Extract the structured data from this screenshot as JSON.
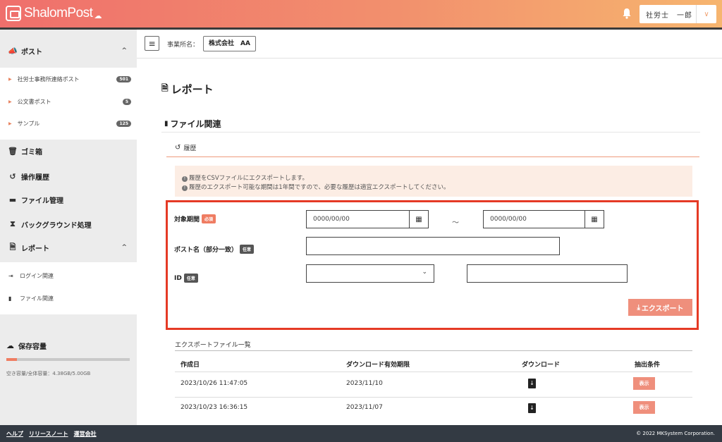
{
  "header": {
    "logo_text": "ShalomPost",
    "user_name": "社労士　一郎",
    "user_chevron": "∨"
  },
  "sidebar": {
    "post": {
      "label": "ポスト",
      "caret": "^"
    },
    "post_items": [
      {
        "label": "社労士事務所連絡ポスト",
        "badge": "501"
      },
      {
        "label": "公文書ポスト",
        "badge": "5"
      },
      {
        "label": "サンプル",
        "badge": "125"
      }
    ],
    "trash": "ゴミ箱",
    "history": "操作履歴",
    "files": "ファイル管理",
    "background": "バックグラウンド処理",
    "report": {
      "label": "レポート",
      "caret": "^"
    },
    "report_items": [
      {
        "label": "ログイン関連"
      },
      {
        "label": "ファイル関連"
      }
    ],
    "storage": {
      "label": "保存容量",
      "used_fraction": 0.0876,
      "text": "空き容量/全体容量：4.38GB/5.00GB"
    }
  },
  "topbar": {
    "office_label": "事業所名：",
    "office_value": "株式会社　AA"
  },
  "main": {
    "title": "レポート",
    "section": "ファイル関連",
    "tab": "履歴",
    "notice": [
      "履歴をCSVファイルにエクスポートします。",
      "履歴のエクスポート可能な期間は1年間ですので、必要な履歴は適宜エクスポートしてください。"
    ],
    "form": {
      "period_label": "対象期間",
      "required_badge": "必須",
      "date_from_placeholder": "0000/00/00",
      "date_to_placeholder": "0000/00/00",
      "tilde": "～",
      "post_name_label": "ポスト名（部分一致）",
      "optional_badge": "任意",
      "id_label": "ID",
      "export_button": "エクスポート"
    },
    "list": {
      "title": "エクスポートファイル一覧",
      "columns": [
        "作成日",
        "ダウンロード有効期限",
        "ダウンロード",
        "抽出条件"
      ],
      "rows": [
        {
          "created": "2023/10/26 11:47:05",
          "expires": "2023/11/10",
          "show": "表示"
        },
        {
          "created": "2023/10/23 16:36:15",
          "expires": "2023/11/07",
          "show": "表示"
        }
      ]
    }
  },
  "footer": {
    "links": [
      "ヘルプ",
      "リリースノート",
      "運営会社"
    ],
    "copyright": "© 2022 MKSystem Corporation."
  },
  "colors": {
    "accent": "#ef8f7c",
    "highlight_border": "#e53a25",
    "footer": "#333a43"
  }
}
